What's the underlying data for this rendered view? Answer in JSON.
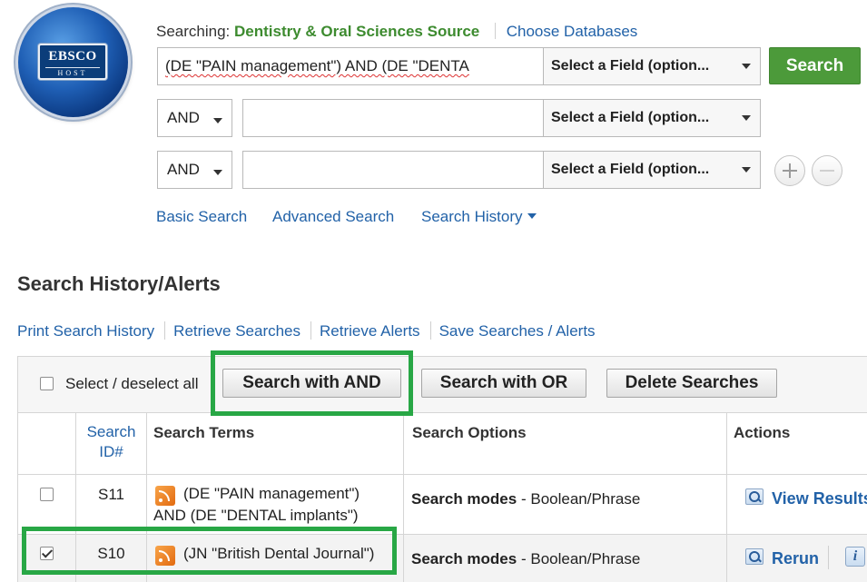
{
  "logo": {
    "top_text": "EBSCO",
    "bottom_text": "HOST"
  },
  "header": {
    "searching_label": "Searching:",
    "database": "Dentistry & Oral Sciences Source",
    "choose_databases": "Choose Databases"
  },
  "query": {
    "rows": [
      {
        "bool": "",
        "value": "(DE \"PAIN management\") AND (DE \"DENTA",
        "field": "Select a Field (option..."
      },
      {
        "bool": "AND",
        "value": "",
        "field": "Select a Field (option..."
      },
      {
        "bool": "AND",
        "value": "",
        "field": "Select a Field (option..."
      }
    ],
    "search_button": "Search"
  },
  "nav": {
    "basic": "Basic Search",
    "advanced": "Advanced Search",
    "history": "Search History"
  },
  "history": {
    "title": "Search History/Alerts",
    "links": [
      "Print Search History",
      "Retrieve Searches",
      "Retrieve Alerts",
      "Save Searches / Alerts"
    ],
    "select_all": "Select / deselect all",
    "buttons": {
      "and": "Search with AND",
      "or": "Search with OR",
      "delete": "Delete Searches"
    },
    "columns": {
      "id_line1": "Search",
      "id_line2": "ID#",
      "terms": "Search Terms",
      "options": "Search Options",
      "actions": "Actions"
    },
    "rows": [
      {
        "id": "S11",
        "checked": false,
        "terms_line1": "(DE \"PAIN management\")",
        "terms_line2": "AND (DE \"DENTAL implants\")",
        "mode_label": "Search modes",
        "mode_value": "- Boolean/Phrase",
        "action": "View Results"
      },
      {
        "id": "S10",
        "checked": true,
        "terms_line1": "(JN \"British Dental Journal\")",
        "mode_label": "Search modes",
        "mode_value": "- Boolean/Phrase",
        "action": "Rerun"
      }
    ]
  },
  "colors": {
    "green_button": "#4c9a3a",
    "link_blue": "#2262a8",
    "highlight": "#28a745",
    "database_green": "#3d8b2f"
  }
}
